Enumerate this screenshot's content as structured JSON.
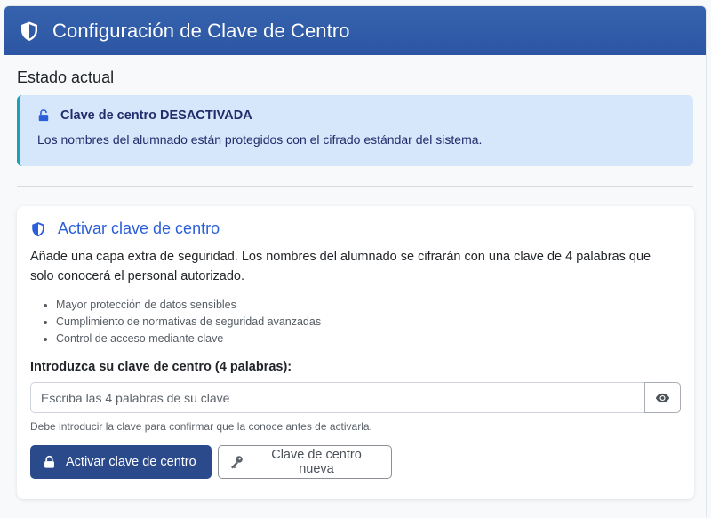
{
  "header": {
    "title": "Configuración de Clave de Centro",
    "icon": "shield-icon"
  },
  "status": {
    "section_title": "Estado actual",
    "alert_title": "Clave de centro DESACTIVADA",
    "alert_text": "Los nombres del alumnado están protegidos con el cifrado estándar del sistema.",
    "alert_icon": "lock-open-icon"
  },
  "activate": {
    "title": "Activar clave de centro",
    "description": "Añade una capa extra de seguridad. Los nombres del alumnado se cifrarán con una clave de 4 palabras que solo conocerá el personal autorizado.",
    "features": [
      "Mayor protección de datos sensibles",
      "Cumplimiento de normativas de seguridad avanzadas",
      "Control de acceso mediante clave"
    ],
    "field_label": "Introduzca su clave de centro (4 palabras):",
    "input_placeholder": "Escriba las 4 palabras de su clave",
    "input_value": "",
    "hint": "Debe introducir la clave para confirmar que la conoce antes de activarla.",
    "primary_button": "Activar clave de centro",
    "secondary_button": "Clave de centro nueva"
  },
  "colors": {
    "header_bg": "#2f5aa6",
    "alert_bg": "#d6e7fb",
    "alert_border": "#17a2b8",
    "accent_blue": "#2b5fd9",
    "primary_button_bg": "#2b4a8c"
  }
}
